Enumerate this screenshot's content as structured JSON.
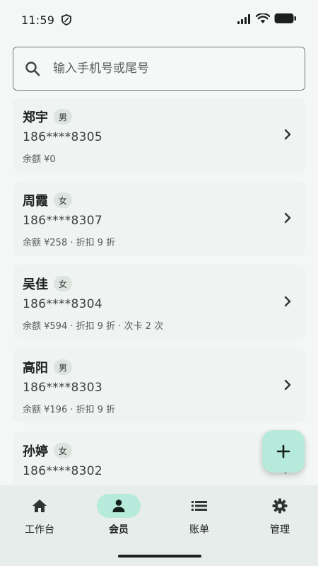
{
  "status_bar": {
    "time": "11:59"
  },
  "search": {
    "placeholder": "输入手机号或尾号"
  },
  "members": [
    {
      "name": "郑宇",
      "gender": "男",
      "phone": "186****8305",
      "detail": "余额 ¥0"
    },
    {
      "name": "周霞",
      "gender": "女",
      "phone": "186****8307",
      "detail": "余额 ¥258 · 折扣 9 折"
    },
    {
      "name": "吴佳",
      "gender": "女",
      "phone": "186****8304",
      "detail": "余额 ¥594 · 折扣 9 折 · 次卡 2 次"
    },
    {
      "name": "高阳",
      "gender": "男",
      "phone": "186****8303",
      "detail": "余额 ¥196 · 折扣 9 折"
    },
    {
      "name": "孙婷",
      "gender": "女",
      "phone": "186****8302",
      "detail": ""
    }
  ],
  "fab": {
    "icon": "plus-icon"
  },
  "bottom_nav": {
    "items": [
      {
        "label": "工作台",
        "icon": "home-icon",
        "active": false
      },
      {
        "label": "会员",
        "icon": "person-icon",
        "active": true
      },
      {
        "label": "账单",
        "icon": "list-icon",
        "active": false
      },
      {
        "label": "管理",
        "icon": "gear-icon",
        "active": false
      }
    ]
  },
  "colors": {
    "background": "#f4f7f5",
    "card": "#eff3f1",
    "accent": "#b6eadb",
    "nav_background": "#e7edea",
    "text": "#1b1f1d"
  }
}
